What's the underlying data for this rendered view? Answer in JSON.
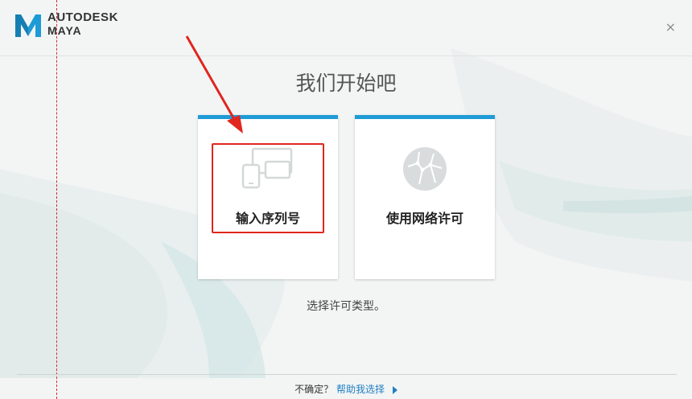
{
  "header": {
    "brand_line1": "AUTODESK",
    "brand_line2": "MAYA",
    "brand_color": "#1d9bd7",
    "close_icon": "×"
  },
  "main": {
    "title": "我们开始吧",
    "options": [
      {
        "label": "输入序列号",
        "icon": "devices-icon"
      },
      {
        "label": "使用网络许可",
        "icon": "network-globe-icon"
      }
    ],
    "instruction": "选择许可类型。"
  },
  "footer": {
    "question": "不确定？",
    "help_link": "帮助我选择"
  },
  "colors": {
    "accent": "#1f9bd7",
    "annotation_red": "#e0261f"
  }
}
